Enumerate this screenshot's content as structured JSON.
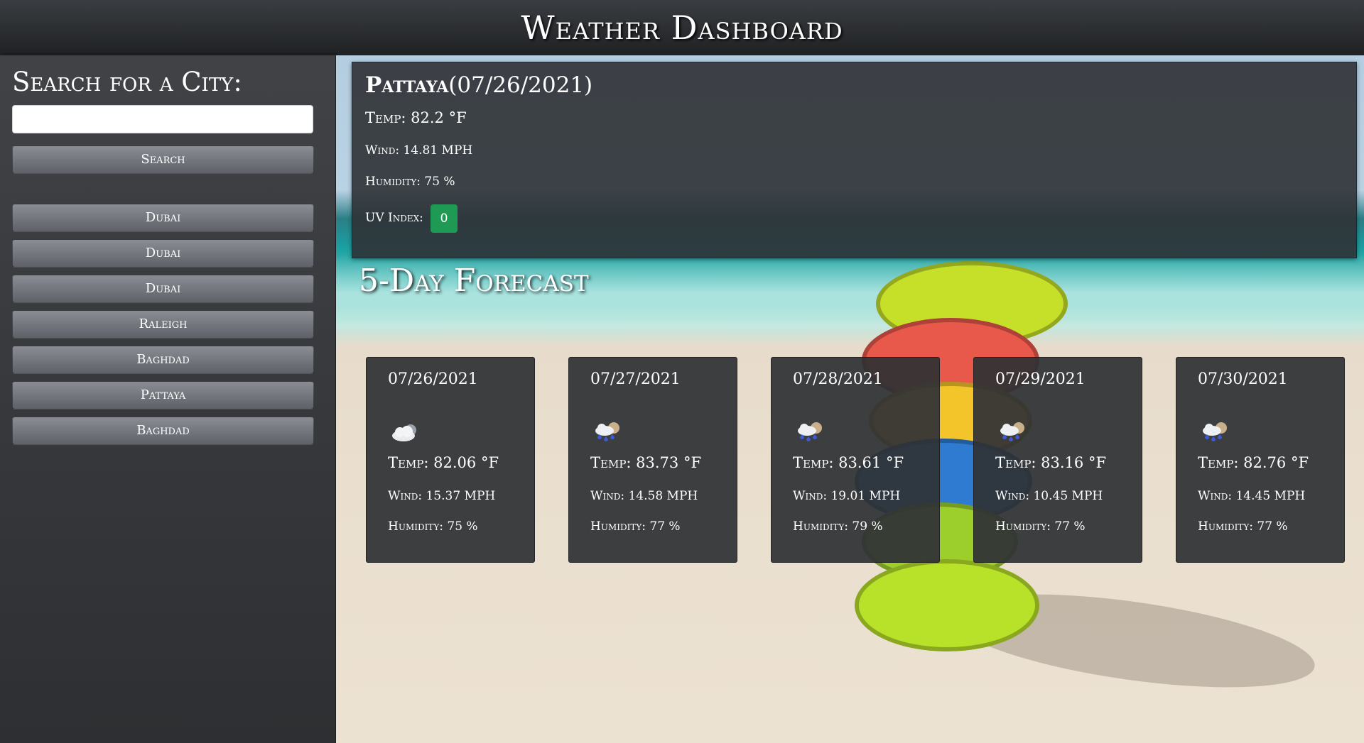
{
  "header": {
    "title": "Weather Dashboard"
  },
  "sidebar": {
    "heading": "Search for a City:",
    "search_value": "",
    "search_button": "Search",
    "history": [
      "Dubai",
      "Dubai",
      "Dubai",
      "Raleigh",
      "Baghdad",
      "Pattaya",
      "Baghdad"
    ]
  },
  "current": {
    "city": "Pattaya",
    "date": "(07/26/2021)",
    "temp": "Temp: 82.2 °F",
    "wind": "Wind: 14.81 MPH",
    "humidity": "Humidity: 75 %",
    "uv_label": "UV Index:",
    "uv_value": "0",
    "uv_color": "#1f9a55"
  },
  "forecast": {
    "title": "5-Day Forecast",
    "days": [
      {
        "date": "07/26/2021",
        "icon": "cloudy-icon",
        "temp": "Temp: 82.06 °F",
        "wind": "Wind: 15.37 MPH",
        "humidity": "Humidity: 75 %"
      },
      {
        "date": "07/27/2021",
        "icon": "rain-icon",
        "temp": "Temp: 83.73 °F",
        "wind": "Wind: 14.58 MPH",
        "humidity": "Humidity: 77 %"
      },
      {
        "date": "07/28/2021",
        "icon": "rain-icon",
        "temp": "Temp: 83.61 °F",
        "wind": "Wind: 19.01 MPH",
        "humidity": "Humidity: 79 %"
      },
      {
        "date": "07/29/2021",
        "icon": "rain-icon",
        "temp": "Temp: 83.16 °F",
        "wind": "Wind: 10.45 MPH",
        "humidity": "Humidity: 77 %"
      },
      {
        "date": "07/30/2021",
        "icon": "rain-icon",
        "temp": "Temp: 82.76 °F",
        "wind": "Wind: 14.45 MPH",
        "humidity": "Humidity: 77 %"
      }
    ]
  }
}
